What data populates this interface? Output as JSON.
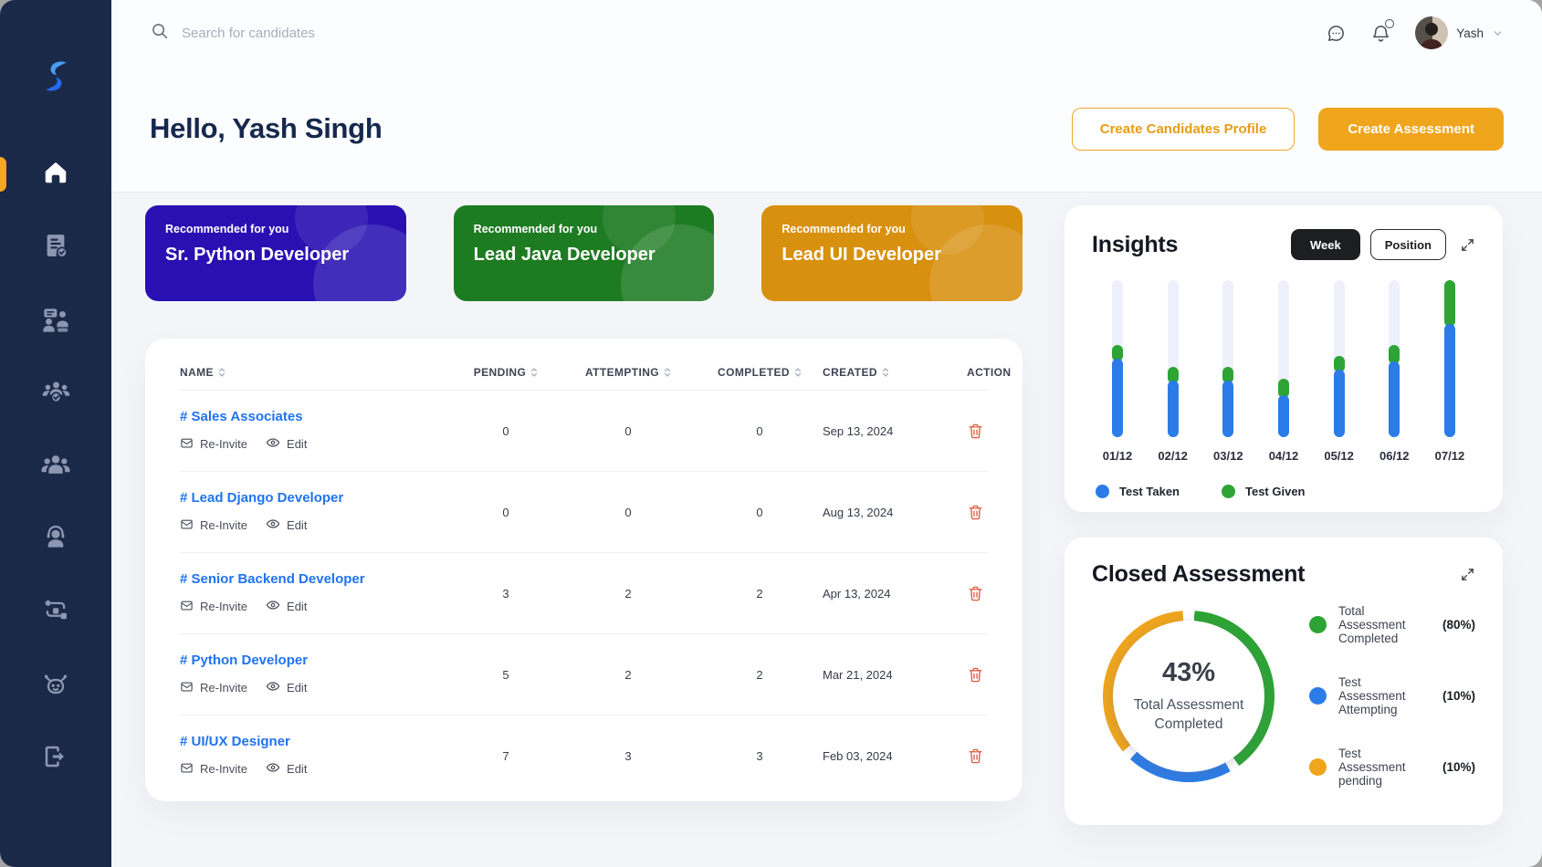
{
  "topbar": {
    "search_placeholder": "Search for candidates",
    "user_name": "Yash"
  },
  "sidebar": {
    "items": [
      {
        "name": "home",
        "active": true
      },
      {
        "name": "assessments",
        "active": false
      },
      {
        "name": "interviews",
        "active": false
      },
      {
        "name": "team-verify",
        "active": false
      },
      {
        "name": "candidates",
        "active": false
      },
      {
        "name": "support",
        "active": false
      },
      {
        "name": "workflow",
        "active": false
      },
      {
        "name": "assistant-bot",
        "active": false
      },
      {
        "name": "logout",
        "active": false
      }
    ]
  },
  "header": {
    "greeting": "Hello, Yash Singh",
    "create_profile_label": "Create Candidates Profile",
    "create_assessment_label": "Create Assessment"
  },
  "recommended": [
    {
      "eyebrow": "Recommended for you",
      "title": "Sr. Python Developer",
      "bg": "#2a10b2"
    },
    {
      "eyebrow": "Recommended for you",
      "title": "Lead Java Developer",
      "bg": "#1d7b21"
    },
    {
      "eyebrow": "Recommended for you",
      "title": "Lead UI Developer",
      "bg": "#d8900f"
    }
  ],
  "table": {
    "columns": [
      "NAME",
      "PENDING",
      "ATTEMPTING",
      "COMPLETED",
      "CREATED",
      "ACTION"
    ],
    "reinvite_label": "Re-Invite",
    "edit_label": "Edit",
    "rows": [
      {
        "name": "# Sales Associates",
        "pending": "0",
        "attempting": "0",
        "completed": "0",
        "created": "Sep 13, 2024"
      },
      {
        "name": "# Lead Django Developer",
        "pending": "0",
        "attempting": "0",
        "completed": "0",
        "created": "Aug 13, 2024"
      },
      {
        "name": "# Senior Backend Developer",
        "pending": "3",
        "attempting": "2",
        "completed": "2",
        "created": "Apr 13, 2024"
      },
      {
        "name": "# Python Developer",
        "pending": "5",
        "attempting": "2",
        "completed": "2",
        "created": "Mar 21, 2024"
      },
      {
        "name": "# UI/UX Designer",
        "pending": "7",
        "attempting": "3",
        "completed": "3",
        "created": "Feb 03, 2024"
      }
    ]
  },
  "insights": {
    "title": "Insights",
    "toggle_week": "Week",
    "toggle_position": "Position",
    "legend": [
      {
        "label": "Test Taken",
        "color": "#2b7ce8"
      },
      {
        "label": "Test Given",
        "color": "#2da434"
      }
    ]
  },
  "closed": {
    "title": "Closed Assessment",
    "center_value": "43%",
    "center_label": "Total Assessment Completed",
    "legend": [
      {
        "label": "Total Assessment Completed",
        "pct": "(80%)",
        "color": "#2da434"
      },
      {
        "label": "Test Assessment Attempting",
        "pct": "(10%)",
        "color": "#2b7ce8"
      },
      {
        "label": "Test Assessment pending",
        "pct": "(10%)",
        "color": "#efa51c"
      }
    ]
  },
  "chart_data": [
    {
      "type": "bar",
      "title": "Insights",
      "categories": [
        "01/12",
        "02/12",
        "03/12",
        "04/12",
        "05/12",
        "06/12",
        "07/12"
      ],
      "series": [
        {
          "name": "Test Taken",
          "color": "#2b7ce8",
          "values": [
            50,
            36,
            36,
            27,
            43,
            48,
            72
          ]
        },
        {
          "name": "Test Given",
          "color": "#2da434",
          "values": [
            9,
            9,
            9,
            10,
            9,
            11,
            28
          ]
        }
      ],
      "ylim": [
        0,
        100
      ],
      "unit": "percent of bar track height (no axis labels shown)",
      "legend_position": "bottom",
      "grid": false
    },
    {
      "type": "pie",
      "title": "Closed Assessment",
      "donut": true,
      "center_value": "43%",
      "center_label": "Total Assessment Completed",
      "slices": [
        {
          "label": "Total Assessment Completed",
          "pct": 80,
          "color": "#2da434"
        },
        {
          "label": "Test Assessment Attempting",
          "pct": 10,
          "color": "#2b7ce8"
        },
        {
          "label": "Test Assessment pending",
          "pct": 10,
          "color": "#efa51c"
        }
      ],
      "arcs_deg": [
        {
          "color": "#2da434",
          "from": 4,
          "to": 144
        },
        {
          "color": "#2b7ce8",
          "from": 151,
          "to": 223
        },
        {
          "color": "#efa51c",
          "from": 230,
          "to": 356
        }
      ],
      "legend_position": "right"
    }
  ],
  "colors": {
    "sidebar_bg": "#1b2949",
    "active_indicator": "#f5a623",
    "accent_orange": "#efa51c",
    "link_blue": "#2073f0",
    "trash_red": "#e15a3c",
    "bar_track": "#eef0fb"
  }
}
